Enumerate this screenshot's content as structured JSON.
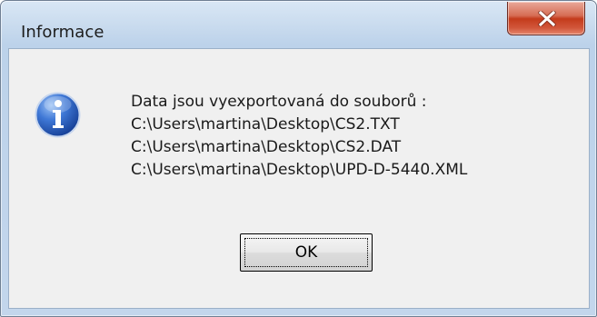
{
  "window": {
    "title": "Informace"
  },
  "message": {
    "lines": [
      "Data jsou vyexportovaná do souborů :",
      "C:\\Users\\martina\\Desktop\\CS2.TXT",
      "C:\\Users\\martina\\Desktop\\CS2.DAT",
      "C:\\Users\\martina\\Desktop\\UPD-D-5440.XML"
    ]
  },
  "buttons": {
    "ok_label": "OK"
  },
  "icons": {
    "info": "information-icon",
    "close": "close-icon"
  },
  "colors": {
    "close_button": "#c43b1c",
    "info_icon": "#2b5fbf",
    "frame": "#bcd2ea"
  }
}
